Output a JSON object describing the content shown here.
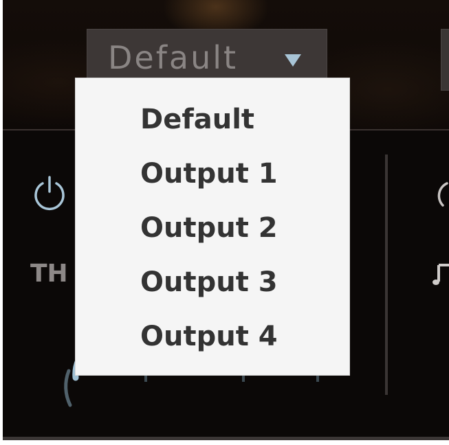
{
  "output_select": {
    "value": "Default",
    "icon": "chevron-down-icon"
  },
  "menu": {
    "items": [
      {
        "label": "Default"
      },
      {
        "label": "Output 1"
      },
      {
        "label": "Output 2"
      },
      {
        "label": "Output 3"
      },
      {
        "label": "Output 4"
      }
    ]
  },
  "left_panel": {
    "label": "TH",
    "power_icon": "power-icon",
    "knob_icon": "knob-icon"
  },
  "right_panel": {
    "power_icon": "power-icon",
    "note_icon": "music-note-icon"
  },
  "colors": {
    "background": "#0b0807",
    "select_bg": "#3d3736",
    "accent": "#a8c4d6",
    "menu_bg": "#f5f5f5",
    "menu_text": "#333333"
  }
}
